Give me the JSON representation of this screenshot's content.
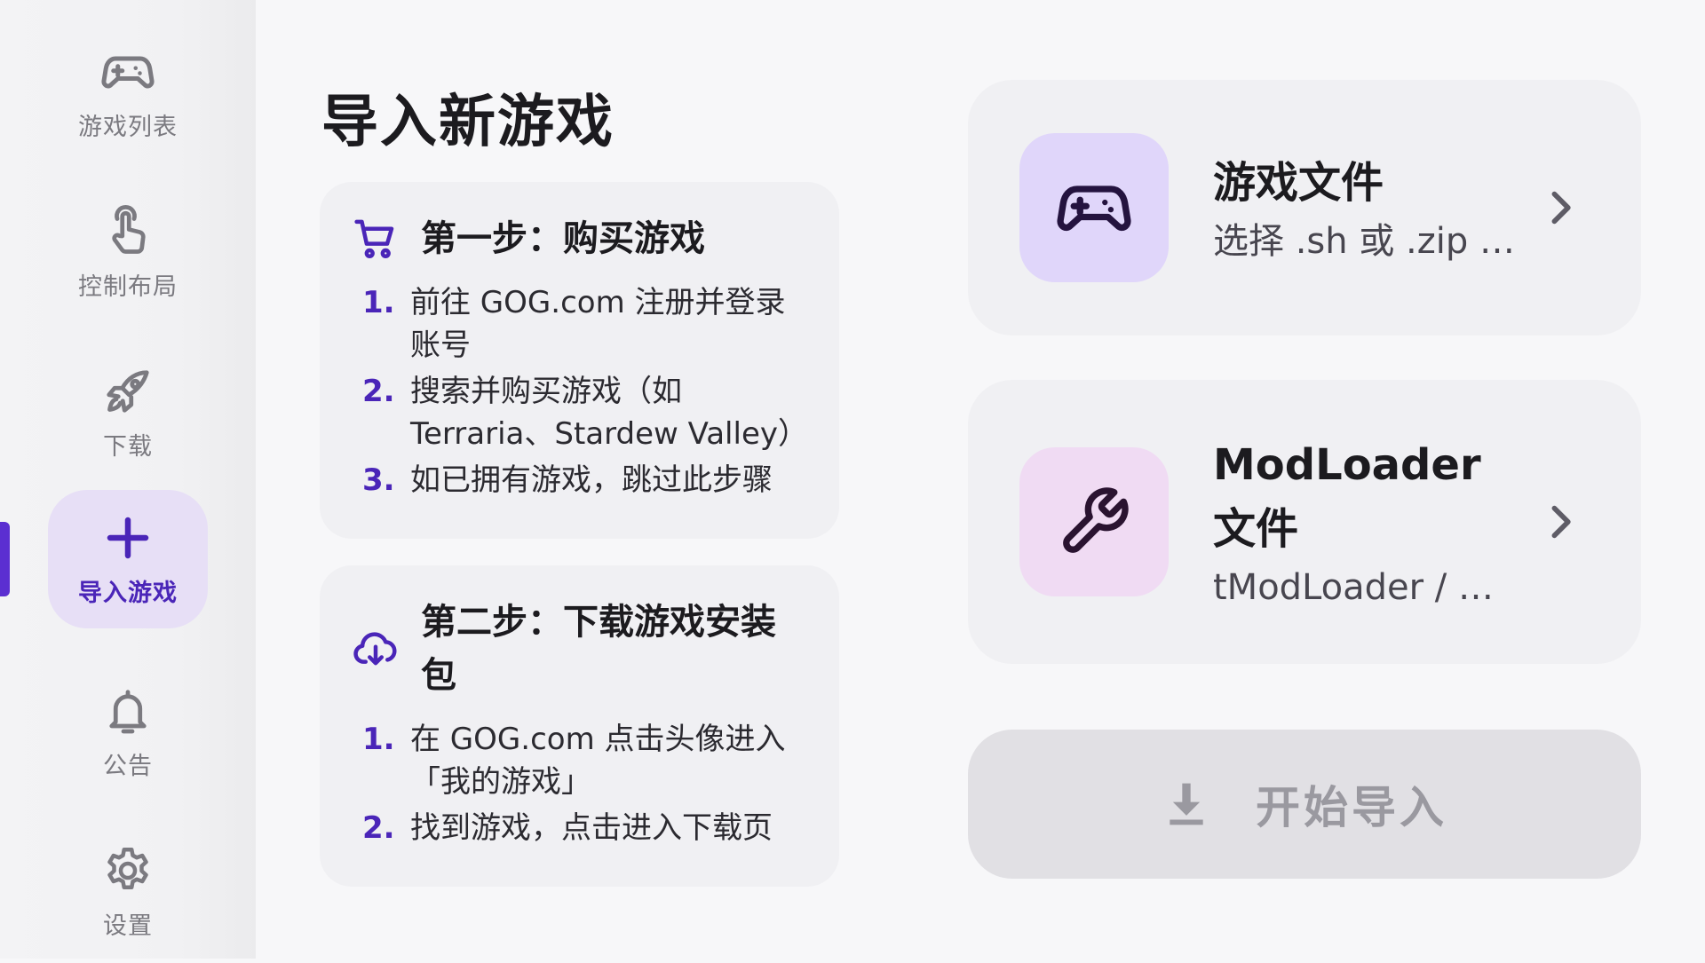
{
  "sidebar": {
    "items": [
      {
        "label": "游戏列表",
        "icon": "gamepad-icon"
      },
      {
        "label": "控制布局",
        "icon": "touch-icon"
      },
      {
        "label": "下载",
        "icon": "rocket-icon"
      },
      {
        "label": "导入游戏",
        "icon": "plus-icon",
        "active": true
      },
      {
        "label": "公告",
        "icon": "bell-icon"
      },
      {
        "label": "设置",
        "icon": "gear-icon"
      }
    ]
  },
  "main": {
    "title": "导入新游戏",
    "steps": [
      {
        "title": "第一步：购买游戏",
        "icon": "cart-icon",
        "items": [
          {
            "num": "1.",
            "text": "前往 GOG.com 注册并登录账号"
          },
          {
            "num": "2.",
            "text": "搜索并购买游戏（如 Terraria、Stardew Valley）"
          },
          {
            "num": "3.",
            "text": "如已拥有游戏，跳过此步骤"
          }
        ]
      },
      {
        "title": "第二步：下载游戏安装包",
        "icon": "cloud-download-icon",
        "items": [
          {
            "num": "1.",
            "text": "在 GOG.com 点击头像进入「我的游戏」"
          },
          {
            "num": "2.",
            "text": "找到游戏，点击进入下载页"
          }
        ]
      }
    ]
  },
  "cards": {
    "game_file": {
      "title": "游戏文件",
      "subtitle": "选择 .sh 或 .zip …",
      "icon": "gamepad-icon"
    },
    "modloader": {
      "title": "ModLoader 文件",
      "subtitle": "tModLoader / S…",
      "icon": "wrench-icon"
    }
  },
  "start_button": {
    "label": "开始导入",
    "icon": "download-icon"
  },
  "colors": {
    "accent": "#4a25b8",
    "active_nav_bg": "#e7dff6",
    "game_icon_bg": "#e0d6fa",
    "mod_icon_bg": "#f0dbf3",
    "card_bg": "#f0f0f3",
    "disabled_button_bg": "#e1e0e4"
  }
}
